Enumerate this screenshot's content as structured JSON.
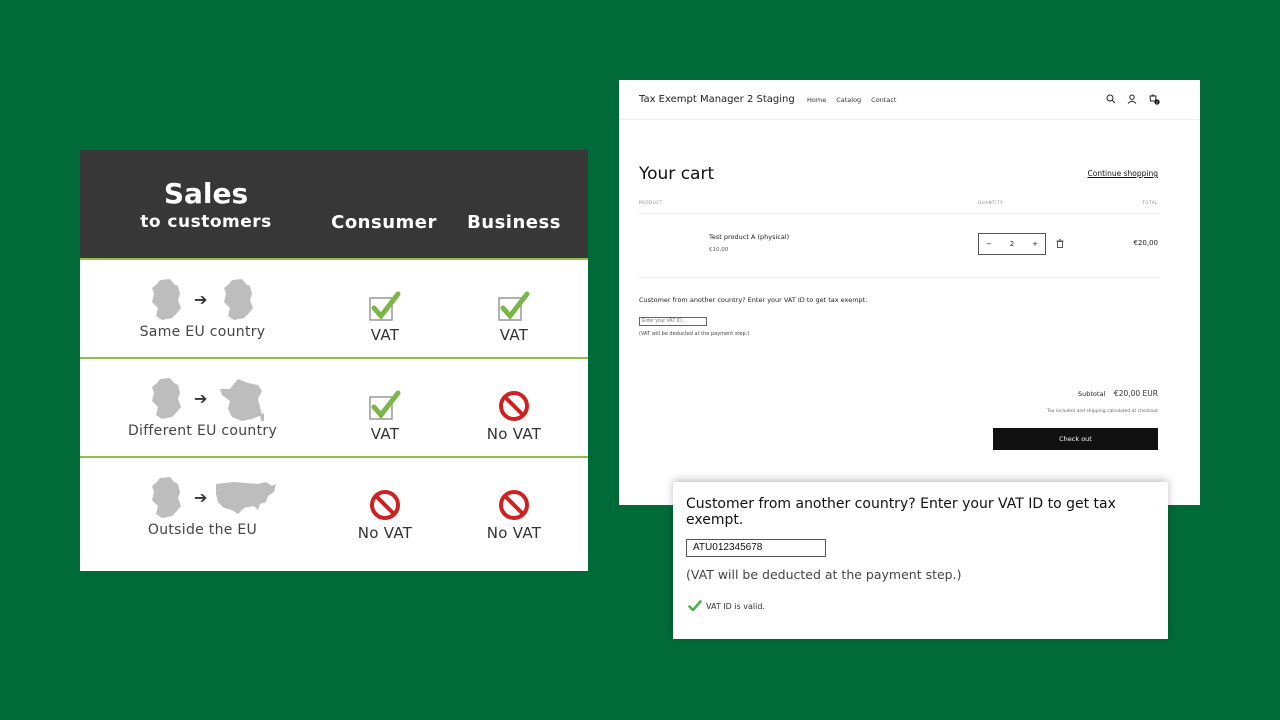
{
  "vat_table": {
    "title": "Sales",
    "subtitle": "to customers",
    "columns": [
      "Consumer",
      "Business"
    ],
    "rows": [
      {
        "label": "Same EU country",
        "consumer": "VAT",
        "business": "VAT",
        "consumer_icon": "check-icon",
        "business_icon": "check-icon"
      },
      {
        "label": "Different EU country",
        "consumer": "VAT",
        "business": "No VAT",
        "consumer_icon": "check-icon",
        "business_icon": "prohibited-icon"
      },
      {
        "label": "Outside the EU",
        "consumer": "No VAT",
        "business": "No VAT",
        "consumer_icon": "prohibited-icon",
        "business_icon": "prohibited-icon"
      }
    ],
    "colors": {
      "header_bg": "#373737",
      "divider": "#8fbf45",
      "check": "#7ab648",
      "prohibited": "#cc2222"
    }
  },
  "shop": {
    "brand": "Tax Exempt Manager 2 Staging",
    "nav": [
      "Home",
      "Catalog",
      "Contact"
    ],
    "icons": [
      "search-icon",
      "account-icon",
      "cart-icon"
    ],
    "cart_count": "2",
    "cart_title": "Your cart",
    "continue_label": "Continue shopping",
    "headers": {
      "product": "PRODUCT",
      "quantity": "QUANTITY",
      "total": "TOTAL"
    },
    "item": {
      "name": "Test product A (physical)",
      "price": "€10,00",
      "quantity": "2",
      "total": "€20,00"
    },
    "vat_prompt": "Customer from another country? Enter your VAT ID to get tax exempt.",
    "vat_placeholder": "Enter your VAT ID...",
    "vat_note": "(VAT will be deducted at the payment step.)",
    "subtotal_label": "Subtotal",
    "subtotal_value": "€20,00 EUR",
    "tax_note": "Tax included and shipping calculated at checkout",
    "checkout_label": "Check out"
  },
  "zoom": {
    "prompt": "Customer from another country? Enter your VAT ID to get tax exempt.",
    "vat_value": "ATU012345678",
    "note": "(VAT will be deducted at the payment step.)",
    "valid_text": "VAT ID is valid.",
    "valid_color": "#4caf50"
  },
  "background_color": "#006b39"
}
